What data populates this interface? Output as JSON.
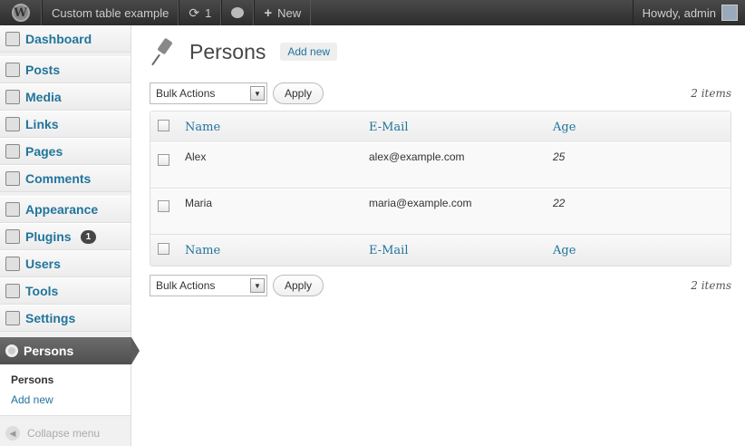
{
  "adminbar": {
    "site_name": "Custom table example",
    "updates_count": "1",
    "new_label": "New",
    "howdy": "Howdy, admin"
  },
  "sidebar": {
    "items": [
      {
        "label": "Dashboard",
        "icon": "dashboard-icon"
      },
      {
        "label": "Posts",
        "icon": "pushpin-icon"
      },
      {
        "label": "Media",
        "icon": "media-icon"
      },
      {
        "label": "Links",
        "icon": "link-icon"
      },
      {
        "label": "Pages",
        "icon": "page-icon"
      },
      {
        "label": "Comments",
        "icon": "comment-icon"
      },
      {
        "label": "Appearance",
        "icon": "appearance-icon"
      },
      {
        "label": "Plugins",
        "icon": "plugin-icon",
        "badge": "1"
      },
      {
        "label": "Users",
        "icon": "users-icon"
      },
      {
        "label": "Tools",
        "icon": "tools-icon"
      },
      {
        "label": "Settings",
        "icon": "settings-icon"
      }
    ],
    "current": {
      "label": "Persons",
      "icon": "gear-icon"
    },
    "submenu": [
      "Persons",
      "Add new"
    ],
    "collapse_label": "Collapse menu"
  },
  "main": {
    "title": "Persons",
    "add_new": "Add new",
    "bulk_actions": "Bulk Actions",
    "apply": "Apply",
    "items_count": "2 items",
    "columns": [
      "Name",
      "E-Mail",
      "Age"
    ],
    "rows": [
      {
        "name": "Alex",
        "email": "alex@example.com",
        "age": "25"
      },
      {
        "name": "Maria",
        "email": "maria@example.com",
        "age": "22"
      }
    ]
  },
  "colors": {
    "link": "#21759b",
    "adminbar": "#464646",
    "current_menu": "#5c5c5c"
  }
}
